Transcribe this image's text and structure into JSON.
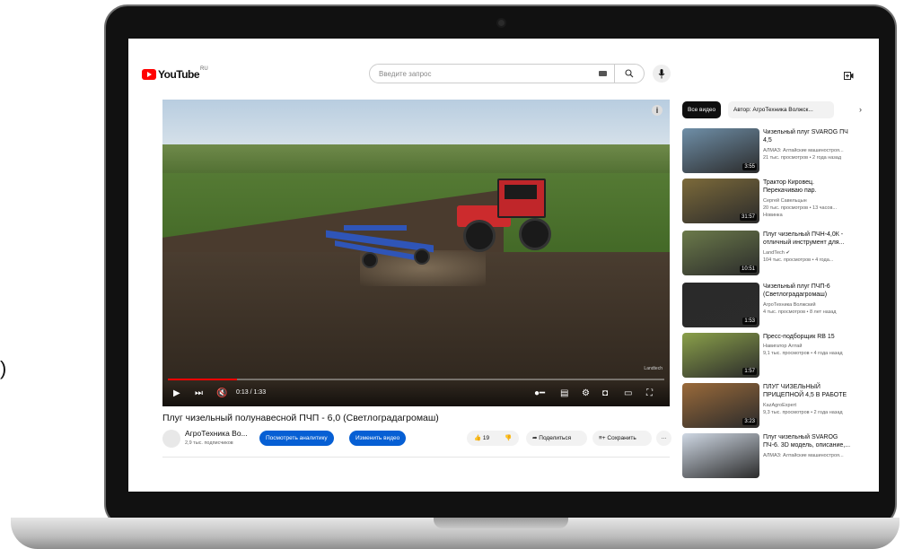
{
  "header": {
    "logo_text": "YouTube",
    "logo_region": "RU",
    "search_placeholder": "Введите запрос"
  },
  "player": {
    "time": "0:13 / 1:33",
    "progress": 0.14,
    "watermark": "Landtech"
  },
  "video": {
    "title": "Плуг чизельный полунавесной ПЧП - 6,0 (Светлоградагромаш)",
    "channel": "АгроТехника Во...",
    "subscribers": "2,9 тыс. подписчиков",
    "analytics_label": "Посмотреть аналитику",
    "edit_label": "Изменить видео",
    "likes": "19",
    "share_label": "Поделиться",
    "save_label": "Сохранить",
    "more_label": "···"
  },
  "sidebar": {
    "chips": [
      "Все видео",
      "Автор: АгроТехника Волжск..."
    ],
    "items": [
      {
        "title_l1": "Чизельный плуг SVAROG ПЧ",
        "title_l2": "4,5",
        "channel": "АЛМАЗ: Алтайские машиностроя...",
        "meta": "21 тыс. просмотров • 2 года назад",
        "duration": "3:55",
        "color": "#6f8fa8"
      },
      {
        "title_l1": "Трактор Кировец.",
        "title_l2": "Перекачиваю пар.",
        "channel": "Сергей Савельцын",
        "meta": "20 тыс. просмотров • 13 часов...",
        "badge": "Новинка",
        "duration": "31:57",
        "color": "#7c6a3a"
      },
      {
        "title_l1": "Плуг чизельный ПЧН-4,0К -",
        "title_l2": "отличный инструмент для...",
        "channel": "LandTech ✔",
        "meta": "104 тыс. просмотров • 4 года...",
        "duration": "10:51",
        "color": "#6b7a4a"
      },
      {
        "title_l1": "Чизельный плуг ПЧП-6",
        "title_l2": "(Светлоградагромаш)",
        "channel": "АгроТехника Волжский",
        "meta": "4 тыс. просмотров • 8 лет назад",
        "duration": "1:53",
        "color": "#2a2a2a"
      },
      {
        "title_l1": "Пресс-подборщик RB 15",
        "title_l2": "",
        "channel": "Навигатор Алтай",
        "meta": "9,1 тыс. просмотров • 4 года назад",
        "duration": "1:57",
        "color": "#8aa04a"
      },
      {
        "title_l1": "ПЛУГ ЧИЗЕЛЬНЫЙ",
        "title_l2": "ПРИЦЕПНОЙ 4,5 В РАБОТЕ",
        "channel": "KazAgroExpert",
        "meta": "9,3 тыс. просмотров • 2 года назад",
        "duration": "3:23",
        "color": "#9a6a3a"
      },
      {
        "title_l1": "Плуг чизельный SVAROG",
        "title_l2": "ПЧ-6. 3D модель, описание,...",
        "channel": "АЛМАЗ: Алтайские машиностроя...",
        "meta": "",
        "duration": "",
        "color": "#cfd8e4"
      }
    ]
  },
  "left_mark": ")"
}
